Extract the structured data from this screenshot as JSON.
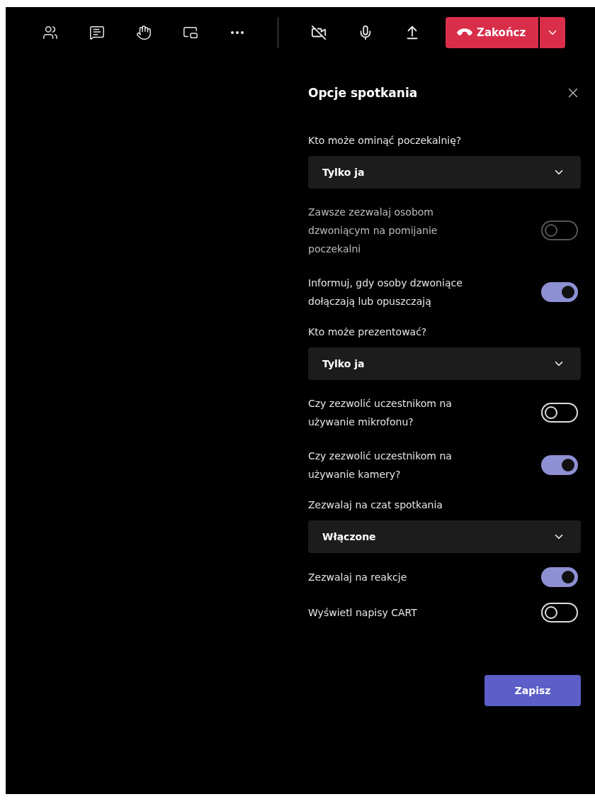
{
  "toolbar": {
    "end_call": {
      "label": "Zakończ"
    }
  },
  "panel": {
    "title": "Opcje spotkania",
    "items": [
      {
        "kind": "label",
        "text": "Kto może ominąć poczekalnię?"
      },
      {
        "kind": "dropdown",
        "value": "Tylko ja"
      },
      {
        "kind": "toggle",
        "text": "Zawsze zezwalaj osobom dzwoniącym na pomijanie poczekalni",
        "on": false,
        "disabled": true
      },
      {
        "kind": "toggle",
        "text": "Informuj, gdy osoby dzwoniące dołączają lub opuszczają",
        "on": true,
        "disabled": false
      },
      {
        "kind": "label",
        "text": "Kto może prezentować?"
      },
      {
        "kind": "dropdown",
        "value": "Tylko ja"
      },
      {
        "kind": "toggle",
        "text": "Czy zezwolić uczestnikom na używanie mikrofonu?",
        "on": false,
        "disabled": false
      },
      {
        "kind": "toggle",
        "text": "Czy zezwolić uczestnikom na używanie kamery?",
        "on": true,
        "disabled": false
      },
      {
        "kind": "label",
        "text": "Zezwalaj na czat spotkania"
      },
      {
        "kind": "dropdown",
        "value": "Włączone"
      },
      {
        "kind": "toggle",
        "text": "Zezwalaj na reakcje",
        "on": true,
        "disabled": false
      },
      {
        "kind": "toggle",
        "text": "Wyświetl napisy CART",
        "on": false,
        "disabled": false
      }
    ],
    "save_button": "Zapisz"
  }
}
